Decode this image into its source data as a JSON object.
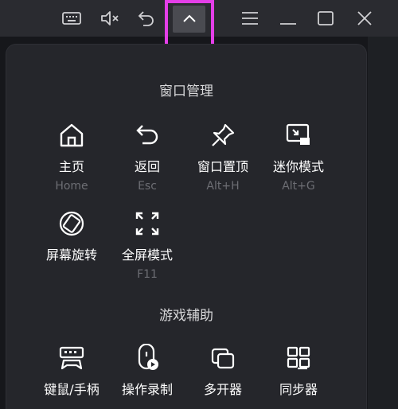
{
  "titlebar": {
    "buttons": [
      {
        "name": "keyboard-icon"
      },
      {
        "name": "mute-icon"
      },
      {
        "name": "undo-icon"
      },
      {
        "name": "collapse-chevron-icon"
      },
      {
        "name": "menu-icon"
      },
      {
        "name": "minimize-icon"
      },
      {
        "name": "maximize-icon"
      },
      {
        "name": "close-icon"
      }
    ]
  },
  "menu": {
    "window_section": {
      "title": "窗口管理",
      "items": [
        {
          "label": "主页",
          "shortcut": "Home",
          "icon": "home-icon"
        },
        {
          "label": "返回",
          "shortcut": "Esc",
          "icon": "back-icon"
        },
        {
          "label": "窗口置顶",
          "shortcut": "Alt+H",
          "icon": "pin-icon"
        },
        {
          "label": "迷你模式",
          "shortcut": "Alt+G",
          "icon": "mini-mode-icon"
        },
        {
          "label": "屏幕旋转",
          "shortcut": "",
          "icon": "rotate-screen-icon"
        },
        {
          "label": "全屏模式",
          "shortcut": "F11",
          "icon": "fullscreen-icon"
        }
      ]
    },
    "game_section": {
      "title": "游戏辅助",
      "items": [
        {
          "label": "键鼠/手柄",
          "icon": "gamepad-icon"
        },
        {
          "label": "操作录制",
          "icon": "record-icon"
        },
        {
          "label": "多开器",
          "icon": "multi-instance-icon"
        },
        {
          "label": "同步器",
          "icon": "sync-icon"
        }
      ]
    }
  },
  "colors": {
    "highlight": "#e43fe8",
    "panel": "#25262b",
    "titlebar": "#2a2b30"
  }
}
